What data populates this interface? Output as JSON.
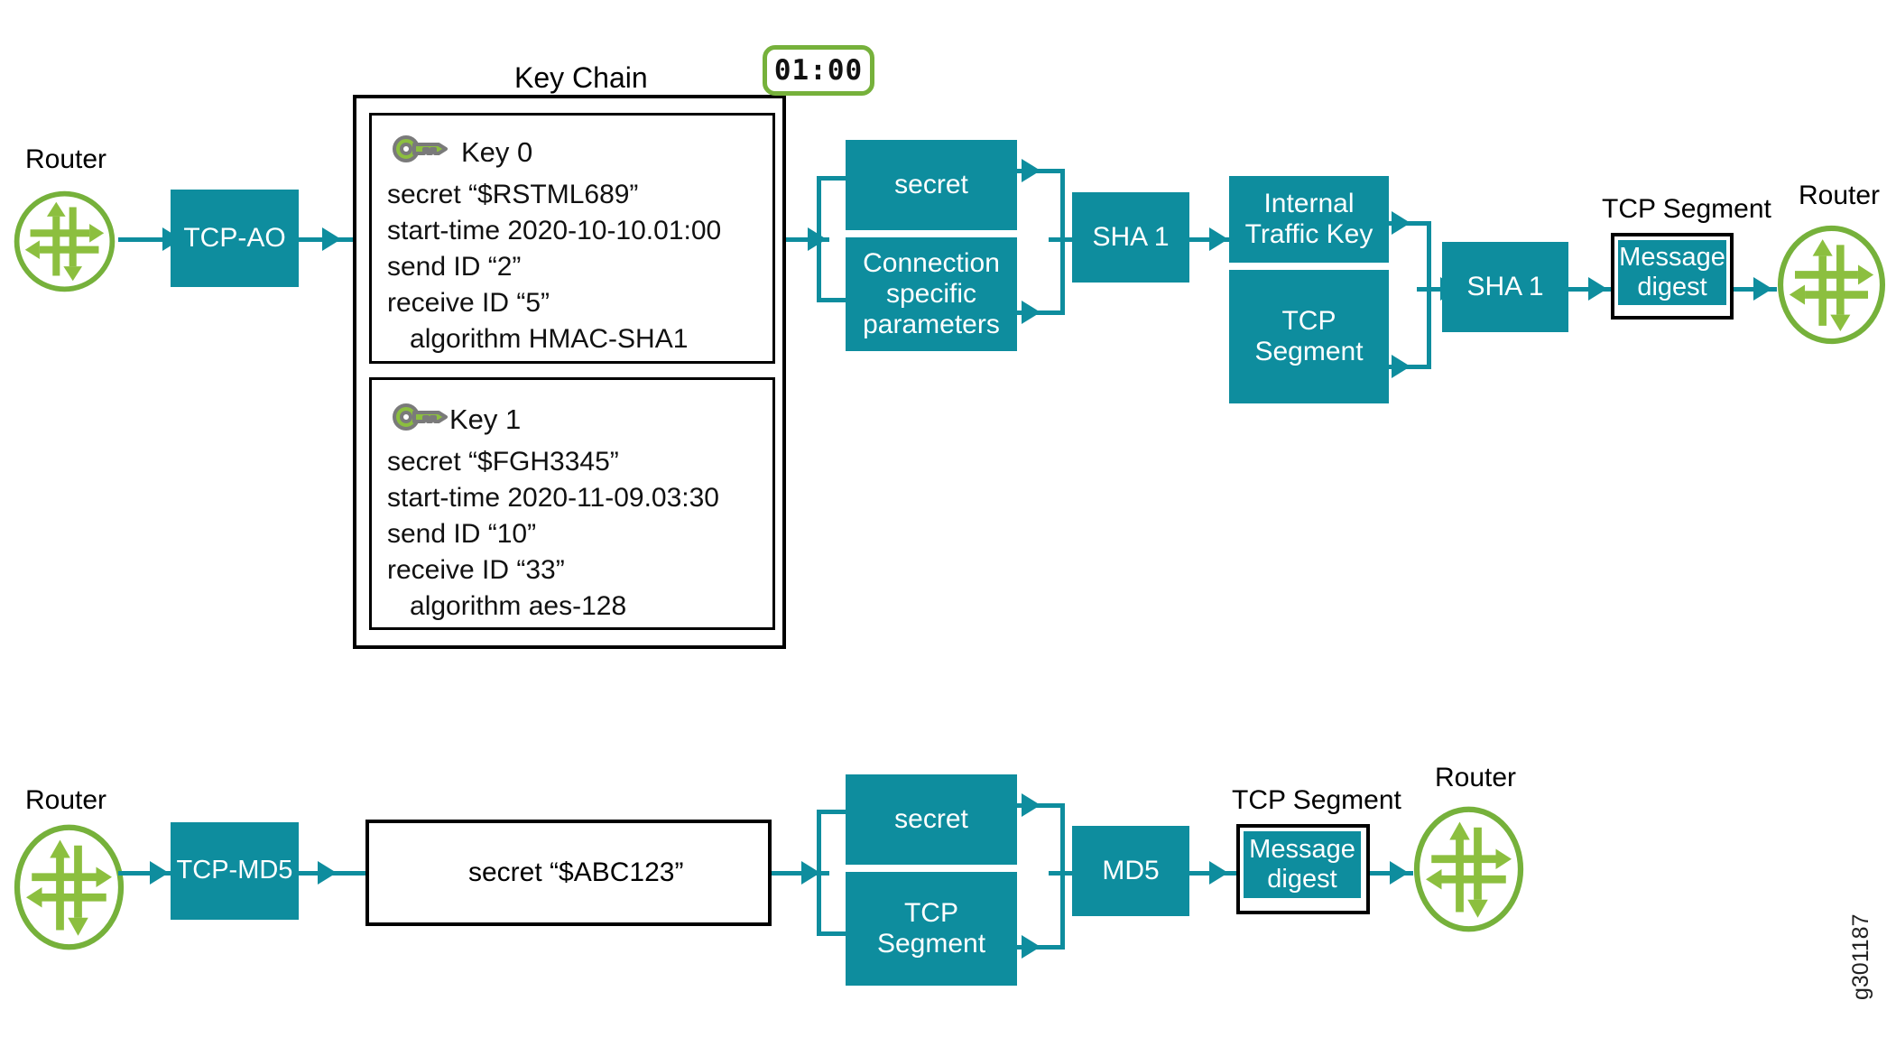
{
  "diagram": {
    "watermark": "g301187",
    "colors": {
      "teal": "#0e8d9e",
      "green": "#76b13b",
      "black": "#000000",
      "white": "#ffffff"
    }
  },
  "timer": {
    "value": "01:00"
  },
  "key_chain": {
    "title": "Key Chain",
    "keys": [
      {
        "icon": "key-icon",
        "name": "Key 0",
        "lines": [
          "secret “$RSTML689”",
          "start-time 2020-10-10.01:00",
          "send ID “2”",
          "receive ID “5”",
          "   algorithm HMAC-SHA1"
        ]
      },
      {
        "icon": "key-icon",
        "name": "Key 1",
        "lines": [
          "secret “$FGH3345”",
          "start-time 2020-11-09.03:30",
          "send ID “10”",
          "receive ID “33”",
          "   algorithm aes-128"
        ]
      }
    ]
  },
  "tcp_ao_flow": {
    "router_left_label": "Router",
    "router_right_label": "Router",
    "protocol_box": "TCP-AO",
    "input_top": "secret",
    "input_bottom": "Connection\nspecific\nparameters",
    "hash_1": "SHA 1",
    "stage2_top": "Internal\nTraffic Key",
    "stage2_bottom": "TCP\nSegment",
    "hash_2": "SHA 1",
    "segment_label": "TCP Segment",
    "digest": "Message\ndigest"
  },
  "tcp_md5_flow": {
    "router_left_label": "Router",
    "router_right_label": "Router",
    "protocol_box": "TCP-MD5",
    "secret_box": "secret “$ABC123”",
    "input_top": "secret",
    "input_bottom": "TCP\nSegment",
    "hash": "MD5",
    "segment_label": "TCP Segment",
    "digest": "Message\ndigest"
  }
}
